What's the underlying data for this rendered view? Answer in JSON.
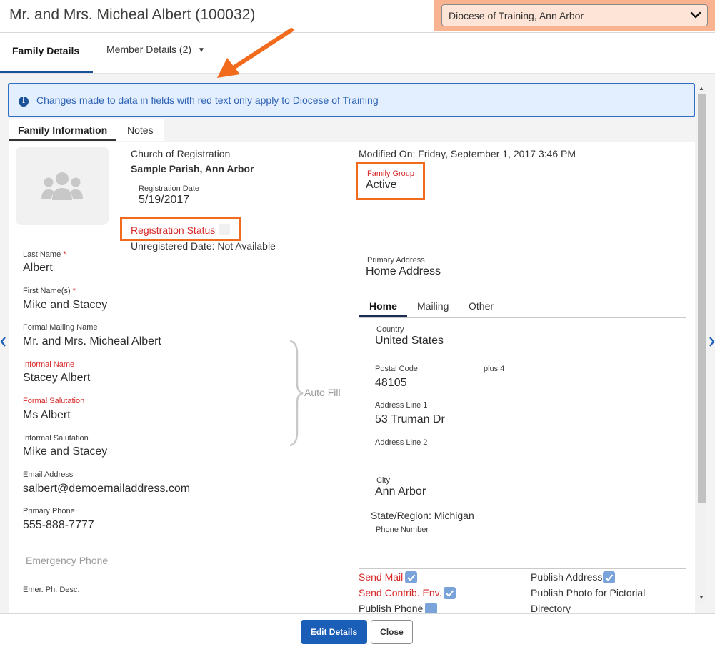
{
  "header": {
    "title": "Mr. and Mrs. Micheal Albert (100032)",
    "diocese_select": "Diocese of Training, Ann Arbor"
  },
  "tabs": {
    "family": "Family Details",
    "member": "Member Details (2)",
    "member_caret": "▼"
  },
  "alert": {
    "icon": "i",
    "text": "Changes made to data in fields with red text only apply to Diocese of Training"
  },
  "subtabs": {
    "family_info": "Family Information",
    "notes": "Notes"
  },
  "registration": {
    "church_label": "Church of Registration",
    "church_value": "Sample Parish, Ann Arbor",
    "date_label": "Registration Date",
    "date_value": "5/19/2017",
    "status_label": "Registration Status",
    "unregistered": "Unregistered Date: Not Available"
  },
  "modified": "Modified On: Friday, September 1, 2017 3:46 PM",
  "family_group": {
    "label": "Family Group",
    "value": "Active"
  },
  "fields": {
    "last_name_label": "Last Name",
    "last_name": "Albert",
    "first_names_label": "First Name(s)",
    "first_names": "Mike and Stacey",
    "formal_mailing_label": "Formal Mailing Name",
    "formal_mailing": "Mr. and Mrs. Micheal Albert",
    "informal_name_label": "Informal Name",
    "informal_name": "Stacey Albert",
    "formal_salutation_label": "Formal Salutation",
    "formal_salutation": "Ms Albert",
    "informal_salutation_label": "Informal Salutation",
    "informal_salutation": "Mike and Stacey",
    "email_label": "Email Address",
    "email": "salbert@demoemailaddress.com",
    "phone_label": "Primary Phone",
    "phone": "555-888-7777",
    "emergency_placeholder": "Emergency Phone",
    "emer_desc_label": "Emer. Ph. Desc.",
    "required_mark": "*"
  },
  "autofill": "Auto Fill",
  "address": {
    "primary_label": "Primary Address",
    "primary_value": "Home Address",
    "tabs": [
      "Home",
      "Mailing",
      "Other"
    ],
    "country_label": "Country",
    "country": "United States",
    "postal_label": "Postal Code",
    "plus4_label": "plus 4",
    "postal": "48105",
    "line1_label": "Address Line 1",
    "line1": "53 Truman Dr",
    "line2_label": "Address Line 2",
    "city_label": "City",
    "city": "Ann Arbor",
    "state": "State/Region: Michigan",
    "phone_label": "Phone Number"
  },
  "options": {
    "send_mail": "Send Mail",
    "send_contrib": "Send Contrib. Env.",
    "publish_phone": "Publish Phone",
    "publish_address": "Publish Address",
    "publish_photo": "Publish Photo for Pictorial",
    "publish_photo_2": "Directory"
  },
  "footer": {
    "edit": "Edit Details",
    "close": "Close"
  },
  "colors": {
    "accent": "#1b5eb8",
    "highlight": "#f26b1d",
    "red_label": "#d82a2a"
  }
}
